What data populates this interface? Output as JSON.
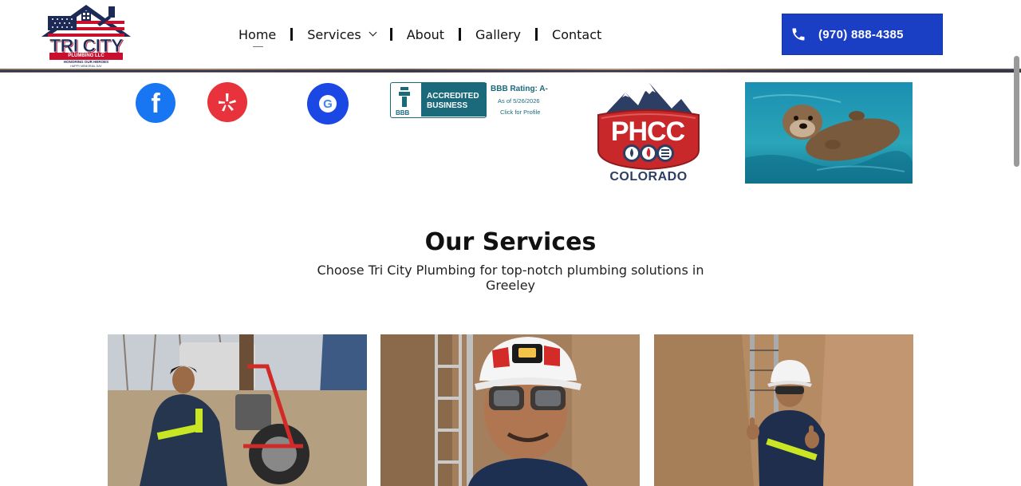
{
  "header": {
    "logo": {
      "title": "TRI CITY",
      "subtitle": "PLUMBING LLC",
      "tagline": "HONORING OUR HEROES",
      "tagline2": "HAPPY MEMORIAL DAY"
    },
    "nav": [
      {
        "label": "Home",
        "has_dropdown": false,
        "active": true
      },
      {
        "label": "Services",
        "has_dropdown": true,
        "active": false
      },
      {
        "label": "About",
        "has_dropdown": false,
        "active": false
      },
      {
        "label": "Gallery",
        "has_dropdown": false,
        "active": false
      },
      {
        "label": "Contact",
        "has_dropdown": false,
        "active": false
      }
    ],
    "phone": {
      "label": "(970) 888-4385",
      "icon": "phone-icon"
    }
  },
  "badges": {
    "facebook": {
      "icon": "facebook-icon",
      "glyph": "f"
    },
    "yelp": {
      "icon": "yelp-icon"
    },
    "google": {
      "icon": "google-icon",
      "glyph": "G"
    },
    "bbb": {
      "seal_text": "BBB",
      "line1": "ACCREDITED",
      "line2": "BUSINESS",
      "rating": "BBB Rating: A-",
      "as_of": "As of 5/26/2026",
      "click": "Click for Profile"
    },
    "phcc": {
      "word": "PHCC",
      "state": "COLORADO"
    },
    "otter": {
      "icon": "otter-photo"
    }
  },
  "services": {
    "title": "Our Services",
    "subtitle": "Choose Tri City Plumbing for top-notch plumbing solutions in Greeley",
    "photos": [
      "plumber-with-drain-machine-photo",
      "plumber-in-hardhat-selfie-photo",
      "plumber-in-trench-thumbs-up-photo"
    ]
  },
  "colors": {
    "accent_blue": "#1a3fc4",
    "facebook": "#1976f2",
    "yelp": "#e8323c",
    "google": "#1b47e5",
    "bbb_teal": "#1b6a7c",
    "phcc_red": "#c8282a",
    "phcc_navy": "#2c3e63"
  }
}
